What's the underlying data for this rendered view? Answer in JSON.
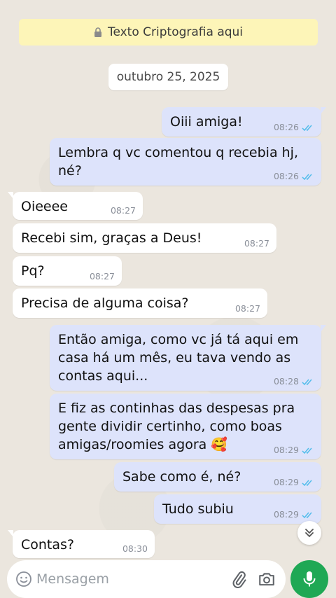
{
  "encryption_notice": "Texto Criptografia aqui",
  "date_chip": "outubro 25, 2025",
  "messages": [
    {
      "dir": "out",
      "text": "Oiii amiga!",
      "time": "08:26",
      "read": true
    },
    {
      "dir": "out",
      "text": "Lembra q vc comentou q recebia hj,\nné?",
      "time": "08:26",
      "read": true
    },
    {
      "dir": "in",
      "text": "Oieeee",
      "time": "08:27"
    },
    {
      "dir": "in",
      "text": "Recebi sim, graças a Deus!",
      "time": "08:27"
    },
    {
      "dir": "in",
      "text": "Pq?",
      "time": "08:27"
    },
    {
      "dir": "in",
      "text": "Precisa de alguma coisa?",
      "time": "08:27"
    },
    {
      "dir": "out",
      "text": "Então amiga, como vc já tá aqui em\ncasa há um mês, eu tava vendo as\ncontas aqui...",
      "time": "08:28",
      "read": true
    },
    {
      "dir": "out",
      "text": "E fiz as continhas das despesas pra\ngente dividir certinho, como boas\namigas/roomies agora 🥰",
      "time": "08:29",
      "read": true
    },
    {
      "dir": "out",
      "text": "Sabe como é, né?",
      "time": "08:29",
      "read": true
    },
    {
      "dir": "out",
      "text": "Tudo subiu",
      "time": "08:29",
      "read": true
    },
    {
      "dir": "in",
      "text": "Contas?",
      "time": "08:30"
    }
  ],
  "composer": {
    "placeholder": "Mensagem"
  },
  "colors": {
    "outgoing_bubble": "#dde3fb",
    "incoming_bubble": "#ffffff",
    "read_ticks": "#53bdeb",
    "mic_button": "#1fa855",
    "encryption_banner": "#fdf5b8"
  },
  "icons": [
    "lock-icon",
    "double-check-icon",
    "chevron-double-down-icon",
    "emoji-icon",
    "paperclip-icon",
    "camera-icon",
    "mic-icon"
  ]
}
